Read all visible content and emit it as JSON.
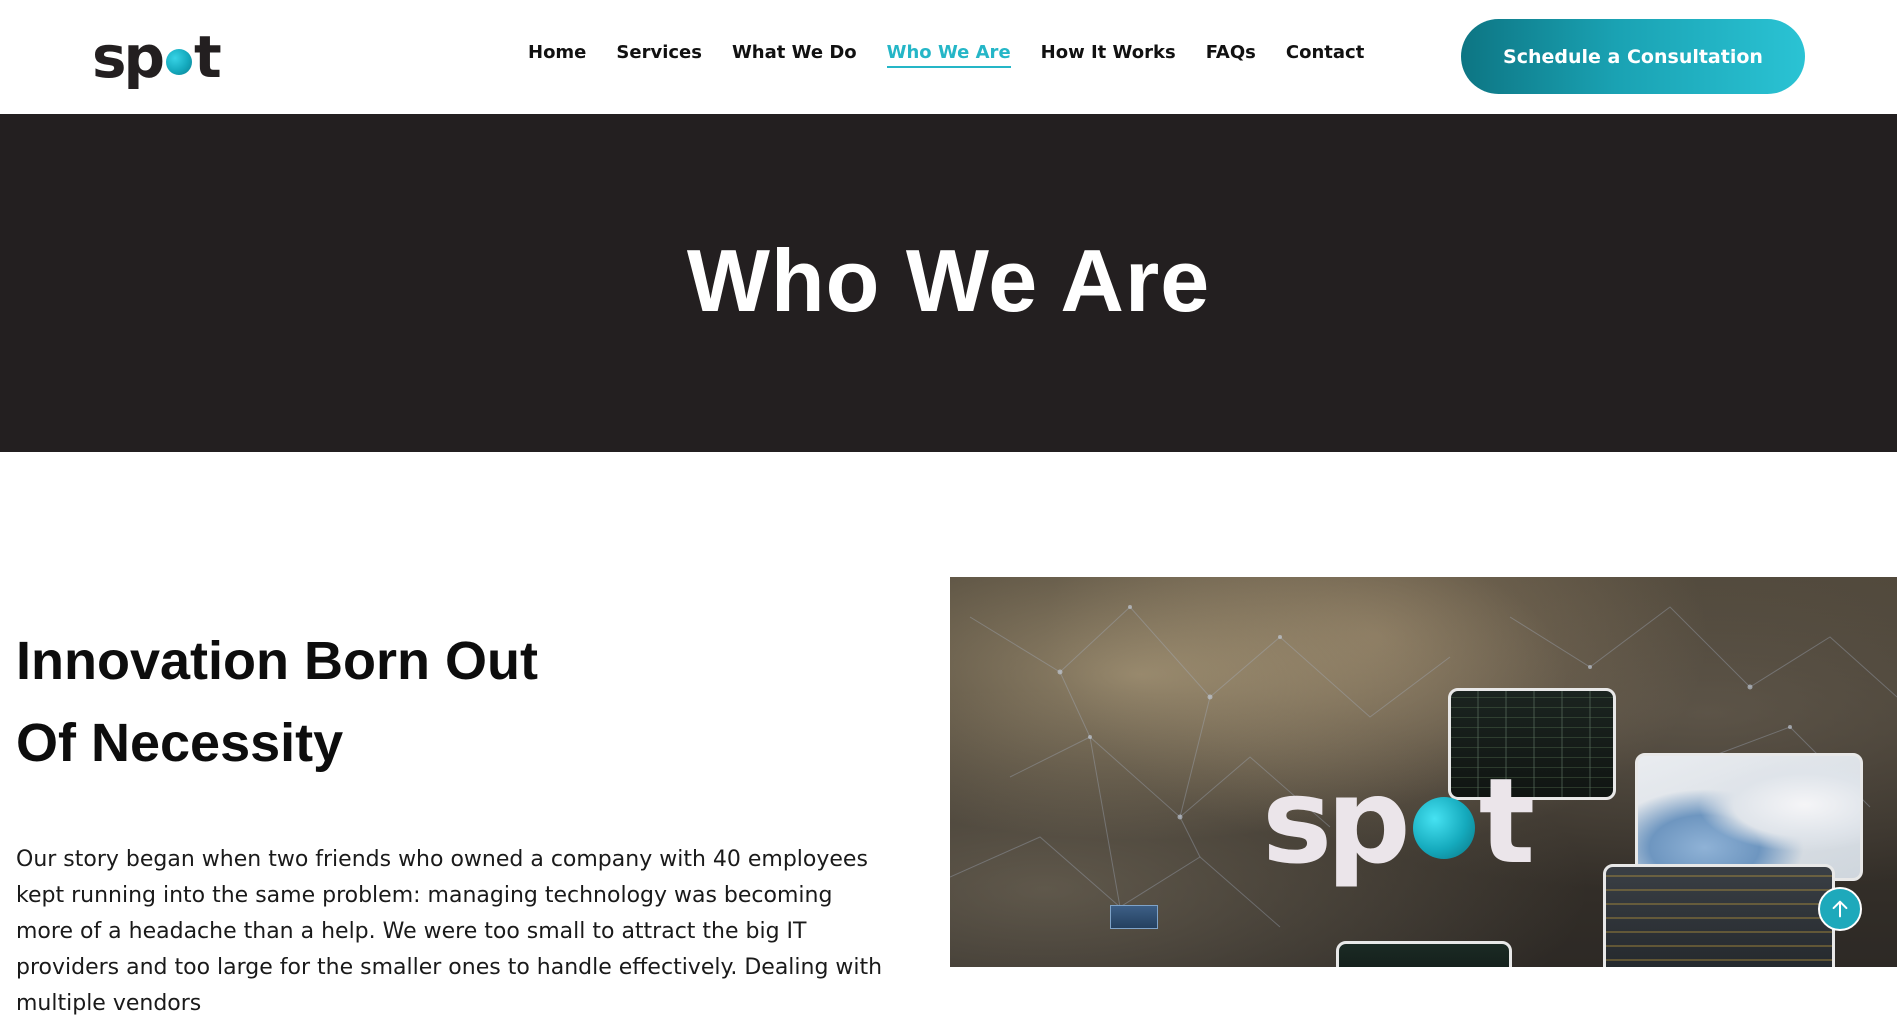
{
  "header": {
    "logo_text_before": "sp",
    "logo_text_after": "t",
    "nav": [
      {
        "label": "Home"
      },
      {
        "label": "Services"
      },
      {
        "label": "What We Do"
      },
      {
        "label": "Who We Are",
        "active": true
      },
      {
        "label": "How It Works"
      },
      {
        "label": "FAQs"
      },
      {
        "label": "Contact"
      }
    ],
    "cta_label": "Schedule a Consultation"
  },
  "hero": {
    "title": "Who We Are"
  },
  "story": {
    "heading_line1": "Innovation Born Out",
    "heading_line2": "Of Necessity",
    "body": "Our story began when two friends who owned a company with 40 employees kept running into the same problem: managing technology was becoming more of a headache than a help. We were too small to attract the big IT providers and too large for the smaller ones to handle effectively. Dealing with multiple vendors"
  },
  "feature_image": {
    "logo_text_before": "sp",
    "logo_text_after": "t"
  },
  "icons": {
    "scroll_top": "arrow-up-icon",
    "logo_dot": "logo-dot-icon"
  },
  "colors": {
    "accent": "#25b6c7",
    "hero_bg": "#231f20",
    "text": "#111111",
    "cta_gradient_start": "#0d7583",
    "cta_gradient_end": "#2ac3d4"
  }
}
